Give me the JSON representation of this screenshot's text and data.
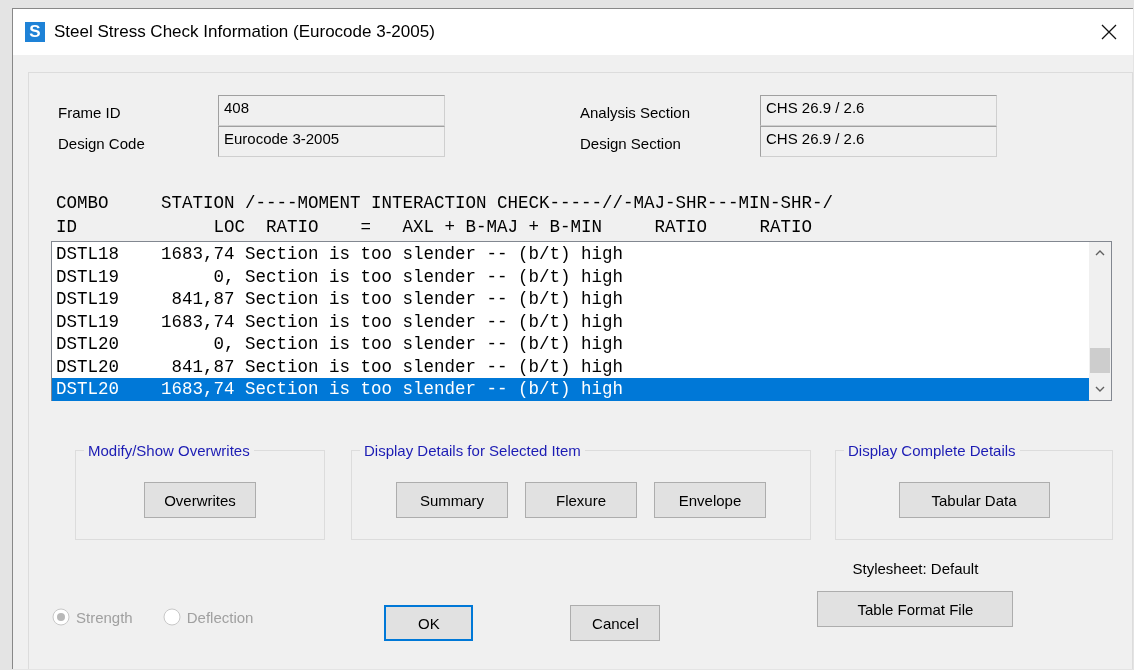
{
  "window": {
    "icon_letter": "S",
    "title": "Steel Stress Check Information (Eurocode 3-2005)"
  },
  "fields": [
    {
      "label": "Frame ID",
      "value": "408"
    },
    {
      "label": "Analysis Section",
      "value": "CHS 26.9 / 2.6"
    },
    {
      "label": "Design Code",
      "value": "Eurocode 3-2005"
    },
    {
      "label": "Design Section",
      "value": "CHS 26.9 / 2.6"
    }
  ],
  "report": {
    "header_lines": [
      "COMBO     STATION /----MOMENT INTERACTION CHECK-----//-MAJ-SHR---MIN-SHR-/",
      "ID             LOC  RATIO    =   AXL + B-MAJ + B-MIN     RATIO     RATIO"
    ],
    "rows": [
      {
        "combo": "DSTL18",
        "station": "1683,74",
        "message": "Section is too slender -- (b/t) high",
        "selected": false
      },
      {
        "combo": "DSTL19",
        "station": "0,",
        "message": "Section is too slender -- (b/t) high",
        "selected": false
      },
      {
        "combo": "DSTL19",
        "station": "841,87",
        "message": "Section is too slender -- (b/t) high",
        "selected": false
      },
      {
        "combo": "DSTL19",
        "station": "1683,74",
        "message": "Section is too slender -- (b/t) high",
        "selected": false
      },
      {
        "combo": "DSTL20",
        "station": "0,",
        "message": "Section is too slender -- (b/t) high",
        "selected": false
      },
      {
        "combo": "DSTL20",
        "station": "841,87",
        "message": "Section is too slender -- (b/t) high",
        "selected": false
      },
      {
        "combo": "DSTL20",
        "station": "1683,74",
        "message": "Section is too slender -- (b/t) high",
        "selected": true
      }
    ]
  },
  "groups": [
    {
      "title": "Modify/Show Overwrites",
      "buttons": [
        "Overwrites"
      ]
    },
    {
      "title": "Display Details for Selected Item",
      "buttons": [
        "Summary",
        "Flexure",
        "Envelope"
      ]
    },
    {
      "title": "Display Complete Details",
      "buttons": [
        "Tabular Data"
      ]
    }
  ],
  "options": [
    {
      "label": "Strength",
      "selected": true,
      "disabled": true
    },
    {
      "label": "Deflection",
      "selected": false,
      "disabled": true
    }
  ],
  "buttons": [
    {
      "label": "OK",
      "default": true
    },
    {
      "label": "Cancel",
      "default": false
    }
  ],
  "stylesheet": {
    "label": "Stylesheet: Default",
    "button": "Table Format File"
  }
}
